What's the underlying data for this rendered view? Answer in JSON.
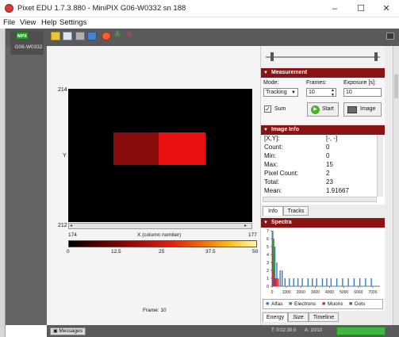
{
  "window": {
    "title": "Pixet EDU 1.7.3.880 - MiniPIX G06-W0332 sn 188",
    "minimize": "–",
    "maximize": "☐",
    "close": "✕"
  },
  "menu": [
    "File",
    "View",
    "Help",
    "Settings"
  ],
  "device": {
    "badge": "MPX",
    "name": "G06-W0332"
  },
  "canvas": {
    "y_top": "214",
    "y_bottom": "212",
    "y_axis_label": "Y",
    "x_left": "174",
    "x_right": "177",
    "x_axis_label": "X (column number)",
    "scale_ticks": [
      "0",
      "12.5",
      "25",
      "37.5",
      "50"
    ],
    "frame_label": "Frame: 10"
  },
  "measurement": {
    "header": "Measurement",
    "mode_label": "Mode:",
    "mode_value": "Tracking",
    "frames_label": "Frames:",
    "frames_value": "10",
    "exposure_label": "Exposure [s]:",
    "exposure_value": "10",
    "sum_label": "Sum",
    "start_label": "Start",
    "image_label": "Image"
  },
  "image_info": {
    "header": "Image Info",
    "rows": [
      {
        "k": "[X,Y]:",
        "v": "[-, -]"
      },
      {
        "k": "Count:",
        "v": "0"
      },
      {
        "k": "Min:",
        "v": "0"
      },
      {
        "k": "Max:",
        "v": "15"
      },
      {
        "k": "Pixel Count:",
        "v": "2"
      },
      {
        "k": "Total:",
        "v": "23"
      },
      {
        "k": "Mean:",
        "v": "1.91667"
      }
    ],
    "tabs": [
      "Info",
      "Tracks"
    ]
  },
  "spectra": {
    "header": "Spectra",
    "legend": [
      "Alfas",
      "Electrons",
      "Muons",
      "Dots"
    ],
    "tabs": [
      "Energy",
      "Size",
      "Timeline"
    ]
  },
  "chart_data": {
    "type": "bar",
    "title": "",
    "xlabel": "",
    "ylabel": "",
    "xlim": [
      0,
      7500
    ],
    "ylim": [
      0,
      7
    ],
    "x_ticks": [
      0,
      1000,
      2000,
      3000,
      4000,
      5000,
      6000,
      7000
    ],
    "y_ticks": [
      0,
      1,
      2,
      3,
      4,
      5,
      6,
      7
    ],
    "series": [
      {
        "name": "Alfas",
        "color": "#2f7fd0",
        "x": [
          50,
          120,
          200,
          330,
          560,
          700,
          900,
          1200,
          1500,
          1800,
          2100,
          2500,
          2800,
          3100,
          3500,
          3800,
          4100,
          4500,
          4900,
          5300,
          5700,
          6100,
          6500,
          6900
        ],
        "values": [
          7,
          6,
          5,
          3,
          2,
          2,
          1,
          1,
          1,
          1,
          1,
          1,
          1,
          1,
          1,
          1,
          1,
          1,
          1,
          1,
          1,
          1,
          1,
          1
        ]
      },
      {
        "name": "Electrons",
        "color": "#2da02d",
        "x": [
          80,
          150,
          260
        ],
        "values": [
          6,
          4,
          1
        ]
      },
      {
        "name": "Muons",
        "color": "#d62828",
        "x": [
          30,
          100,
          180,
          240,
          300,
          420
        ],
        "values": [
          5,
          2,
          1,
          1,
          1,
          1
        ]
      },
      {
        "name": "Dots",
        "color": "#7a3fa8",
        "x": [
          60,
          140
        ],
        "values": [
          1,
          1
        ]
      }
    ]
  },
  "status": {
    "messages": "Messages",
    "timer": "T: 0:02:30.0",
    "count": "A: 10/10"
  },
  "colors": {
    "accent": "#8b1313",
    "frame_gray": "#5a5a5a",
    "progress_green": "#3fb83f"
  }
}
